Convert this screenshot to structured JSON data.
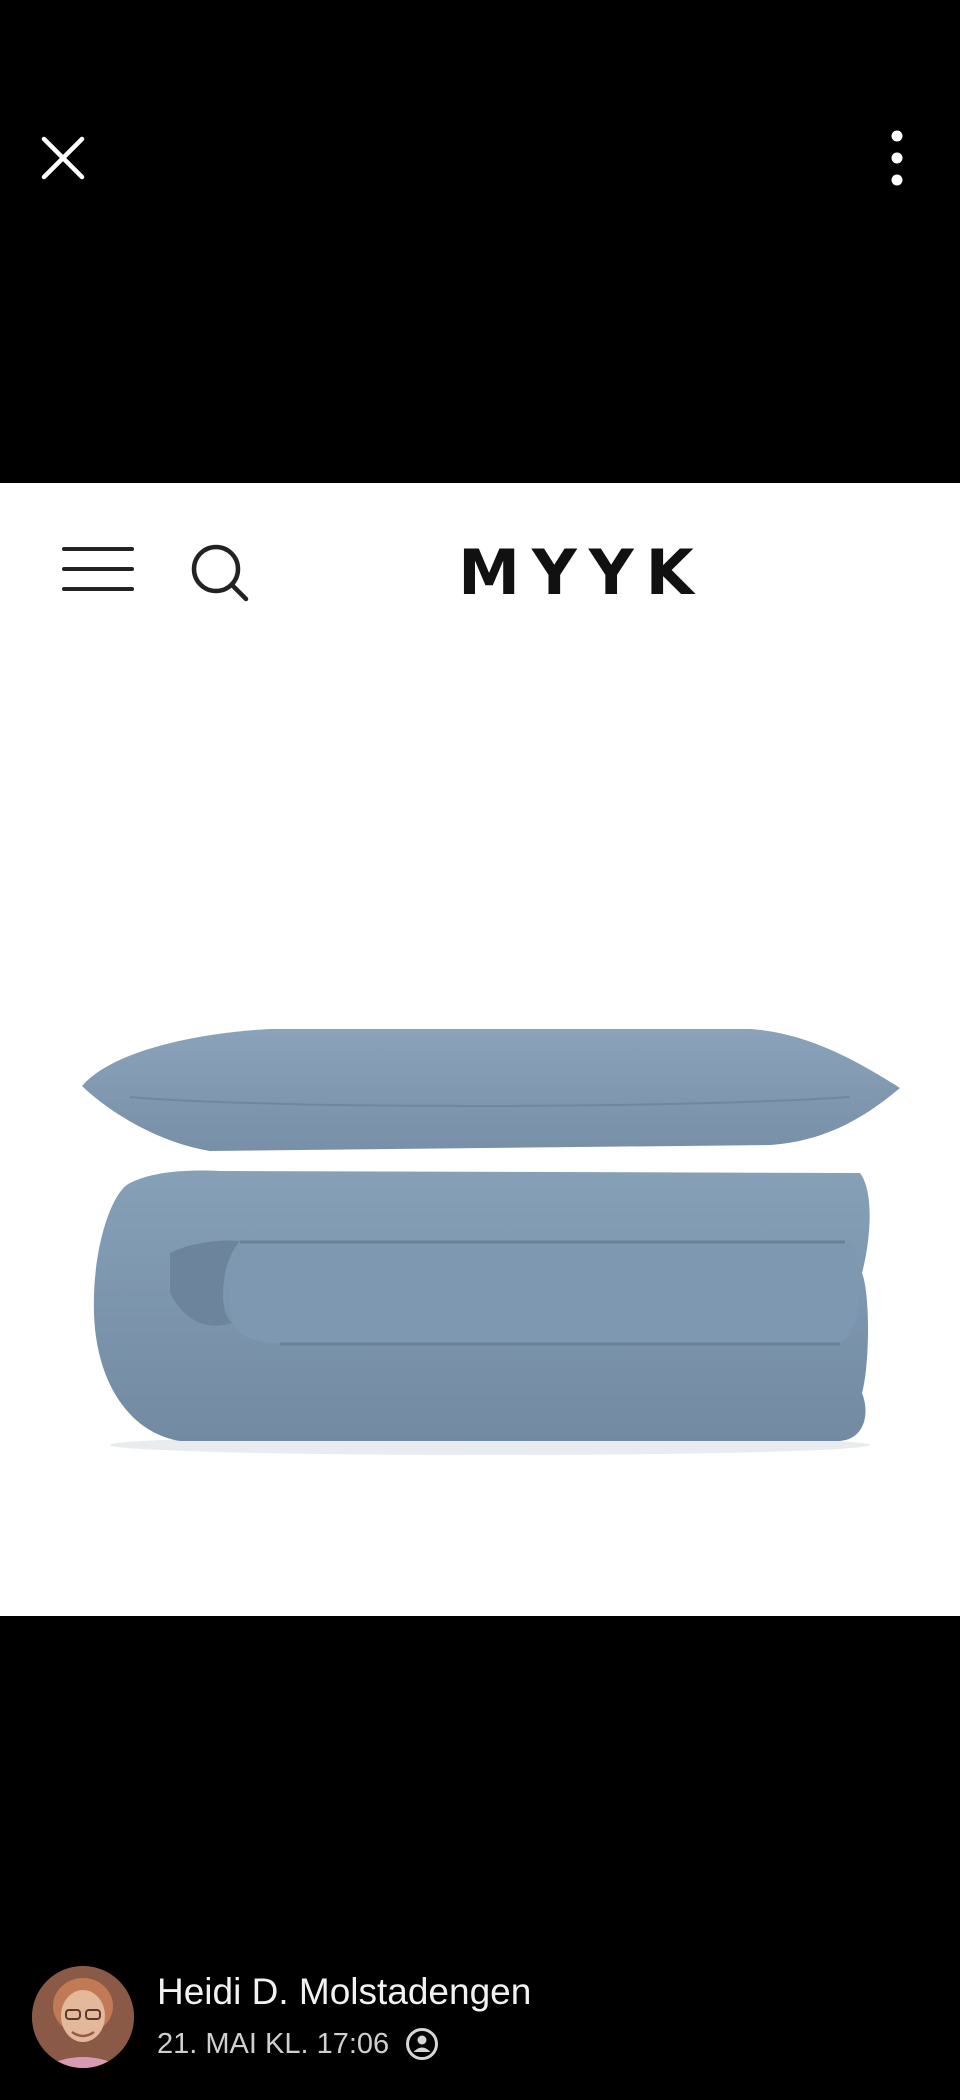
{
  "viewer": {
    "close_icon": "close-icon",
    "more_icon": "more-vertical-icon"
  },
  "photo": {
    "site": {
      "logo_text": "MYYK",
      "menu_icon": "hamburger-menu-icon",
      "search_icon": "search-icon"
    },
    "product": "folded blue duvet with pillow",
    "product_color": "#7f97b0"
  },
  "post": {
    "author_name": "Heidi D. Molstadengen",
    "timestamp": "21. MAI KL. 17:06",
    "audience_icon": "friends-audience-icon"
  }
}
